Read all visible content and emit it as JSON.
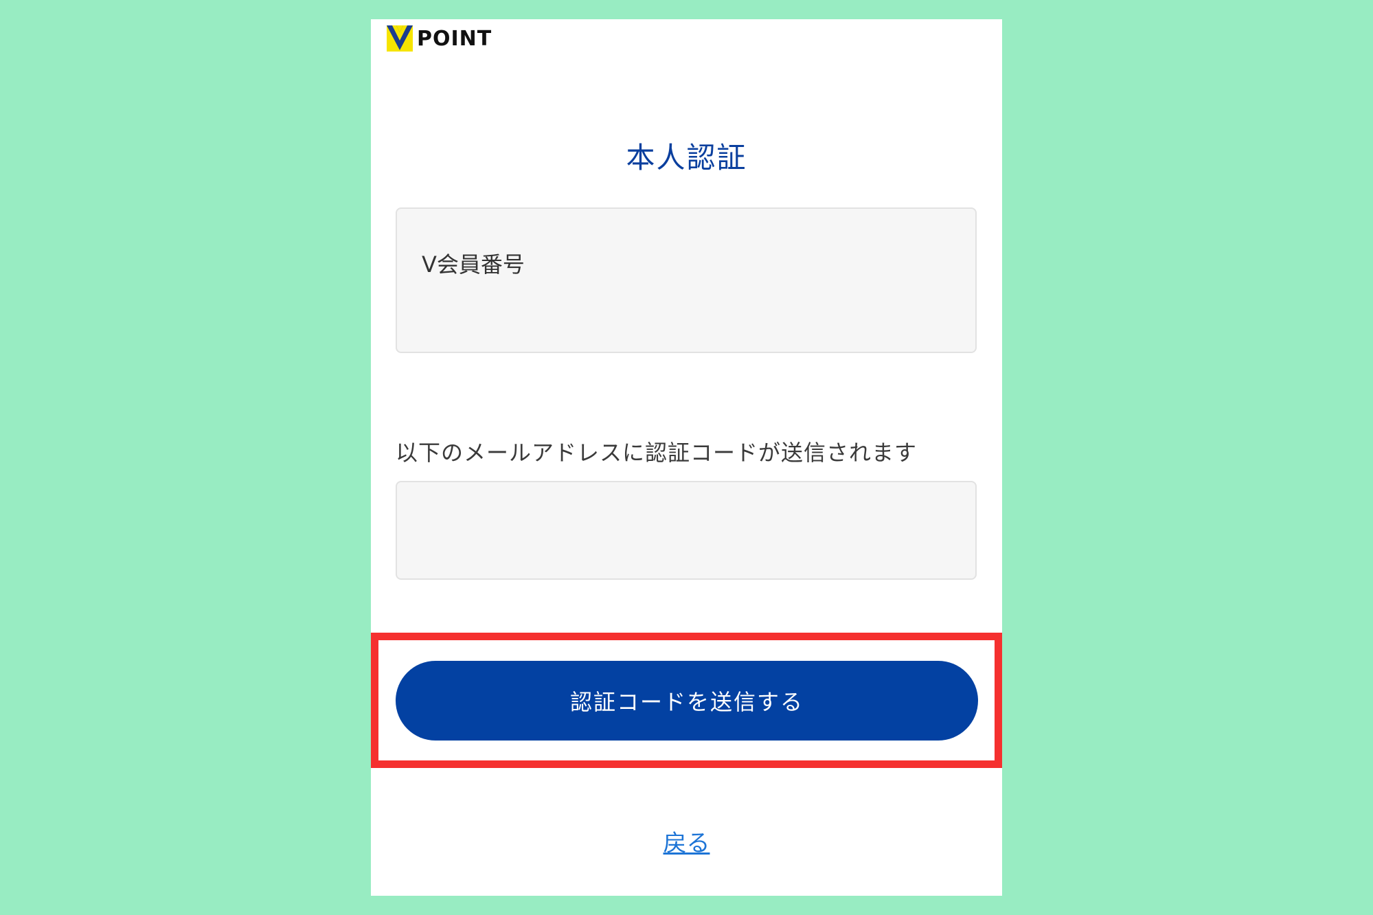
{
  "header": {
    "logo_text": "POINT",
    "logo_icon": "v-logo-icon"
  },
  "page": {
    "title": "本人認証"
  },
  "member_field": {
    "label": "V会員番号",
    "value": ""
  },
  "email_section": {
    "note": "以下のメールアドレスに認証コードが送信されます",
    "value": ""
  },
  "actions": {
    "send_code_label": "認証コードを送信する",
    "back_label": "戻る"
  },
  "colors": {
    "background": "#98ecc2",
    "brand_blue": "#0341a2",
    "title_blue": "#0a3f9e",
    "highlight_red": "#f5302f",
    "link_blue": "#1d74d6",
    "logo_yellow": "#f6e400",
    "logo_navy": "#1a3c8f"
  }
}
